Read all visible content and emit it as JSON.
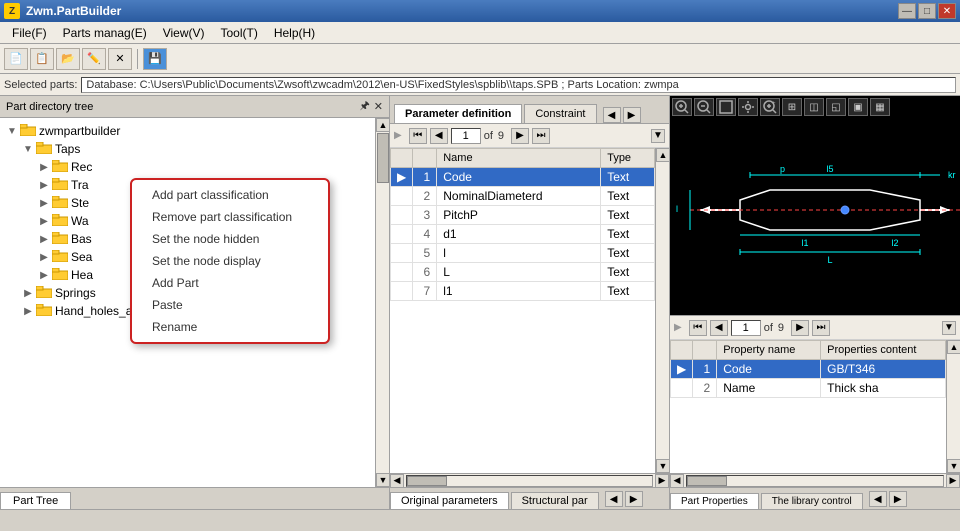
{
  "app": {
    "title": "Zwm.PartBuilder",
    "icon": "Z"
  },
  "titlebar": {
    "minimize_label": "—",
    "maximize_label": "□",
    "close_label": "✕"
  },
  "menubar": {
    "items": [
      {
        "id": "file",
        "label": "File(F)"
      },
      {
        "id": "parts",
        "label": "Parts manag(E)"
      },
      {
        "id": "view",
        "label": "View(V)"
      },
      {
        "id": "tool",
        "label": "Tool(T)"
      },
      {
        "id": "help",
        "label": "Help(H)"
      }
    ]
  },
  "toolbar": {
    "buttons": [
      "📄",
      "📋",
      "📂",
      "✏️",
      "✕",
      "💾"
    ]
  },
  "selected_parts": {
    "label": "Selected parts:",
    "value": "Database: C:\\Users\\Public\\Documents\\Zwsoft\\zwcadm\\2012\\en-US\\FixedStyles\\spblib\\\\taps.SPB ; Parts Location: zwmpa"
  },
  "left_panel": {
    "header": "Part directory tree",
    "pin_label": "🖈",
    "close_label": "✕",
    "tree_items": [
      {
        "id": "root",
        "label": "zwmpartbuilder",
        "level": 0,
        "expanded": true,
        "icon": "folder"
      },
      {
        "id": "taps",
        "label": "Taps",
        "level": 1,
        "expanded": true,
        "icon": "folder"
      },
      {
        "id": "rec",
        "label": "Rec",
        "level": 2,
        "expanded": false,
        "icon": "folder",
        "partial": true
      },
      {
        "id": "tra",
        "label": "Tra",
        "level": 2,
        "expanded": false,
        "icon": "folder",
        "partial": true
      },
      {
        "id": "ste",
        "label": "Ste",
        "level": 2,
        "expanded": false,
        "icon": "folder",
        "partial": true
      },
      {
        "id": "wa",
        "label": "Wa",
        "level": 2,
        "expanded": false,
        "icon": "folder",
        "partial": true
      },
      {
        "id": "bas",
        "label": "Bas",
        "level": 2,
        "expanded": false,
        "icon": "folder",
        "partial": true
      },
      {
        "id": "sea",
        "label": "Sea",
        "level": 2,
        "expanded": false,
        "icon": "folder",
        "partial": true
      },
      {
        "id": "hea",
        "label": "Hea",
        "level": 2,
        "expanded": false,
        "icon": "folder",
        "partial": true
      },
      {
        "id": "springs",
        "label": "Springs",
        "level": 1,
        "expanded": false,
        "icon": "folder"
      },
      {
        "id": "manholes",
        "label": "Hand_holes_and_manholes",
        "level": 1,
        "expanded": false,
        "icon": "folder"
      }
    ],
    "tab": "Part Tree"
  },
  "context_menu": {
    "items": [
      {
        "id": "add-classification",
        "label": "Add part classification"
      },
      {
        "id": "remove-classification",
        "label": "Remove part classification"
      },
      {
        "id": "set-hidden",
        "label": "Set the node hidden"
      },
      {
        "id": "set-display",
        "label": "Set the node display"
      },
      {
        "id": "add-part",
        "label": "Add Part"
      },
      {
        "id": "paste",
        "label": "Paste"
      },
      {
        "id": "rename",
        "label": "Rename"
      }
    ]
  },
  "middle_panel": {
    "tabs": [
      {
        "id": "param-def",
        "label": "Parameter definition",
        "active": true
      },
      {
        "id": "constraint",
        "label": "Constraint"
      }
    ],
    "nav": {
      "first_label": "⏮",
      "prev_label": "◀",
      "current": "1",
      "of_label": "of",
      "total": "9",
      "next_label": "▶",
      "last_label": "⏭"
    },
    "table": {
      "columns": [
        {
          "id": "indicator",
          "label": ""
        },
        {
          "id": "num",
          "label": ""
        },
        {
          "id": "name",
          "label": "Name"
        },
        {
          "id": "type",
          "label": "Type"
        }
      ],
      "rows": [
        {
          "num": "1",
          "name": "Code",
          "type": "Text",
          "selected": true
        },
        {
          "num": "2",
          "name": "NominalDiameterd",
          "type": "Text"
        },
        {
          "num": "3",
          "name": "PitchP",
          "type": "Text"
        },
        {
          "num": "4",
          "name": "d1",
          "type": "Text"
        },
        {
          "num": "5",
          "name": "l",
          "type": "Text"
        },
        {
          "num": "6",
          "name": "L",
          "type": "Text"
        },
        {
          "num": "7",
          "name": "l1",
          "type": "Text"
        }
      ]
    },
    "bottom_tabs": [
      {
        "id": "orig-params",
        "label": "Original parameters",
        "active": true
      },
      {
        "id": "struct-par",
        "label": "Structural par"
      }
    ]
  },
  "right_panel": {
    "cad_toolbar_buttons": [
      "🔍+",
      "🔍-",
      "⬜",
      "⚙",
      "🔍×",
      "⊞",
      "◫",
      "◱",
      "▣",
      "▦"
    ],
    "props": {
      "nav": {
        "first_label": "⏮",
        "prev_label": "◀",
        "current": "1",
        "of_label": "of",
        "total": "9",
        "next_label": "▶",
        "last_label": "⏭"
      },
      "table": {
        "columns": [
          {
            "id": "indicator",
            "label": ""
          },
          {
            "id": "num",
            "label": ""
          },
          {
            "id": "prop-name",
            "label": "Property name"
          },
          {
            "id": "prop-content",
            "label": "Properties content"
          }
        ],
        "rows": [
          {
            "num": "1",
            "prop_name": "Code",
            "prop_content": "GB/T346",
            "selected": true
          },
          {
            "num": "2",
            "prop_name": "Name",
            "prop_content": "Thick sha"
          }
        ]
      },
      "bottom_tabs": [
        {
          "id": "part-props",
          "label": "Part Properties",
          "active": true
        },
        {
          "id": "lib-control",
          "label": "The library control"
        }
      ]
    }
  },
  "cad": {
    "colors": {
      "background": "#000000",
      "cyan": "#00ffff",
      "white": "#ffffff",
      "red": "#ff4444",
      "blue": "#4444ff",
      "yellow": "#ffff00"
    }
  }
}
